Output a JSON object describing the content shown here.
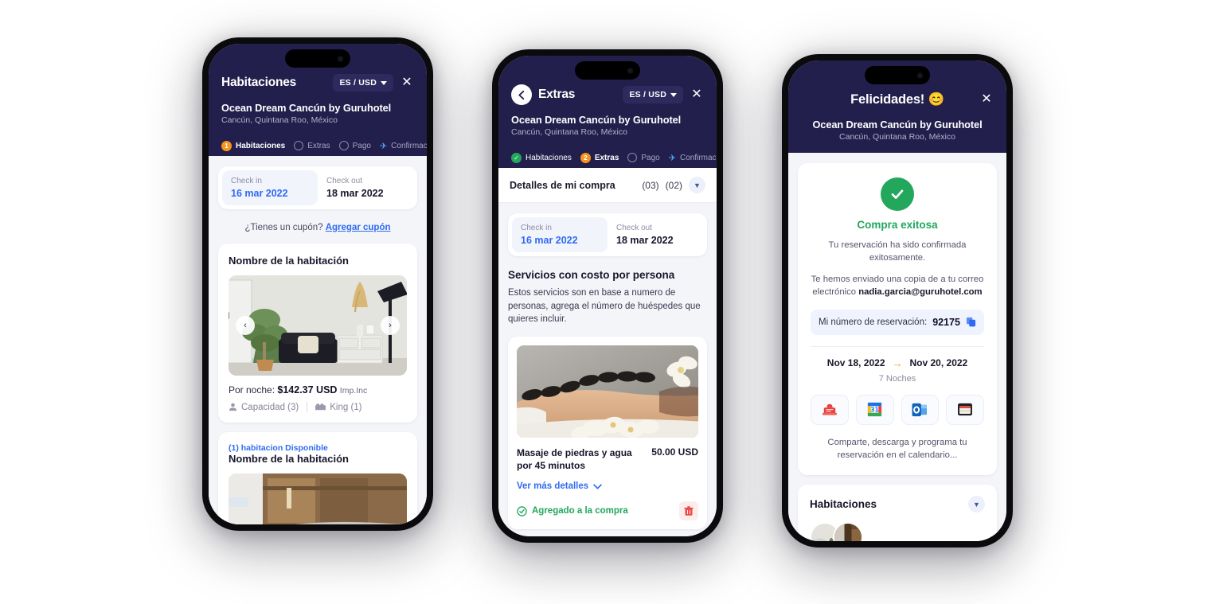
{
  "hotel": {
    "name": "Ocean Dream Cancún by Guruhotel",
    "location": "Cancún, Quintana Roo, México"
  },
  "common": {
    "lang_currency": "ES / USD",
    "close_label": "✕",
    "check_in_label": "Check in",
    "check_out_label": "Check out",
    "check_in_value": "16 mar 2022",
    "check_out_value": "18 mar 2022"
  },
  "phone1": {
    "header_title": "Habitaciones",
    "steps": [
      {
        "label": "Habitaciones",
        "marker": "1",
        "state": "active"
      },
      {
        "label": "Extras",
        "marker": "circle",
        "state": "pending"
      },
      {
        "label": "Pago",
        "marker": "circle",
        "state": "pending"
      },
      {
        "label": "Confirmación",
        "marker": "plane",
        "state": "pending"
      }
    ],
    "coupon_question": "¿Tienes un cupón?",
    "coupon_link": "Agregar cupón",
    "room1": {
      "title": "Nombre de la habitación",
      "price_label": "Por noche:",
      "price": "$142.37 USD",
      "tax_note": "Imp.Inc",
      "capacity": "Capacidad (3)",
      "bed": "King (1)",
      "prev_label": "‹",
      "next_label": "›"
    },
    "room2": {
      "availability": "(1) habitacion Disponible",
      "title": "Nombre de la habitación"
    }
  },
  "phone2": {
    "header_title": "Extras",
    "back_label": "←",
    "steps": [
      {
        "label": "Habitaciones",
        "marker": "check",
        "state": "done"
      },
      {
        "label": "Extras",
        "marker": "2",
        "state": "active"
      },
      {
        "label": "Pago",
        "marker": "circle",
        "state": "pending"
      },
      {
        "label": "Confirmación",
        "marker": "plane",
        "state": "pending"
      }
    ],
    "purchase_bar": {
      "title": "Detalles de mi compra",
      "count_a": "(03)",
      "count_b": "(02)"
    },
    "section_title": "Servicios con costo por persona",
    "section_desc": "Estos servicios son en base a numero de personas, agrega el número de huéspedes que quieres incluir.",
    "service": {
      "name": "Masaje de piedras y agua por 45 minutos",
      "price": "50.00 USD",
      "more_details": "Ver más detalles",
      "added_text": "Agregado a la compra",
      "delete_label": "🗑"
    }
  },
  "phone3": {
    "header_title": "Felicidades! 😊",
    "success_title": "Compra exitosa",
    "confirm_line1": "Tu reservación ha sido confirmada exitosamente.",
    "confirm_line2_pre": "Te hemos enviado una copia de a tu correo electrónico ",
    "confirm_email": "nadia.garcia@guruhotel.com",
    "reservation_label": "Mi número de reservación:",
    "reservation_number": "92175",
    "date_from": "Nov 18, 2022",
    "date_to": "Nov 20, 2022",
    "nights": "7 Noches",
    "actions": [
      {
        "name": "pdf-icon"
      },
      {
        "name": "google-calendar-icon"
      },
      {
        "name": "outlook-icon"
      },
      {
        "name": "calendar-icon"
      }
    ],
    "share_note": "Comparte, descarga y programa tu reservación en el calendario...",
    "rooms_title": "Habitaciones"
  },
  "colors": {
    "header_bg": "#231f4d",
    "accent_orange": "#f7941e",
    "link_blue": "#2f6bf2",
    "success_green": "#22a75d",
    "body_bg": "#f4f5f9"
  }
}
